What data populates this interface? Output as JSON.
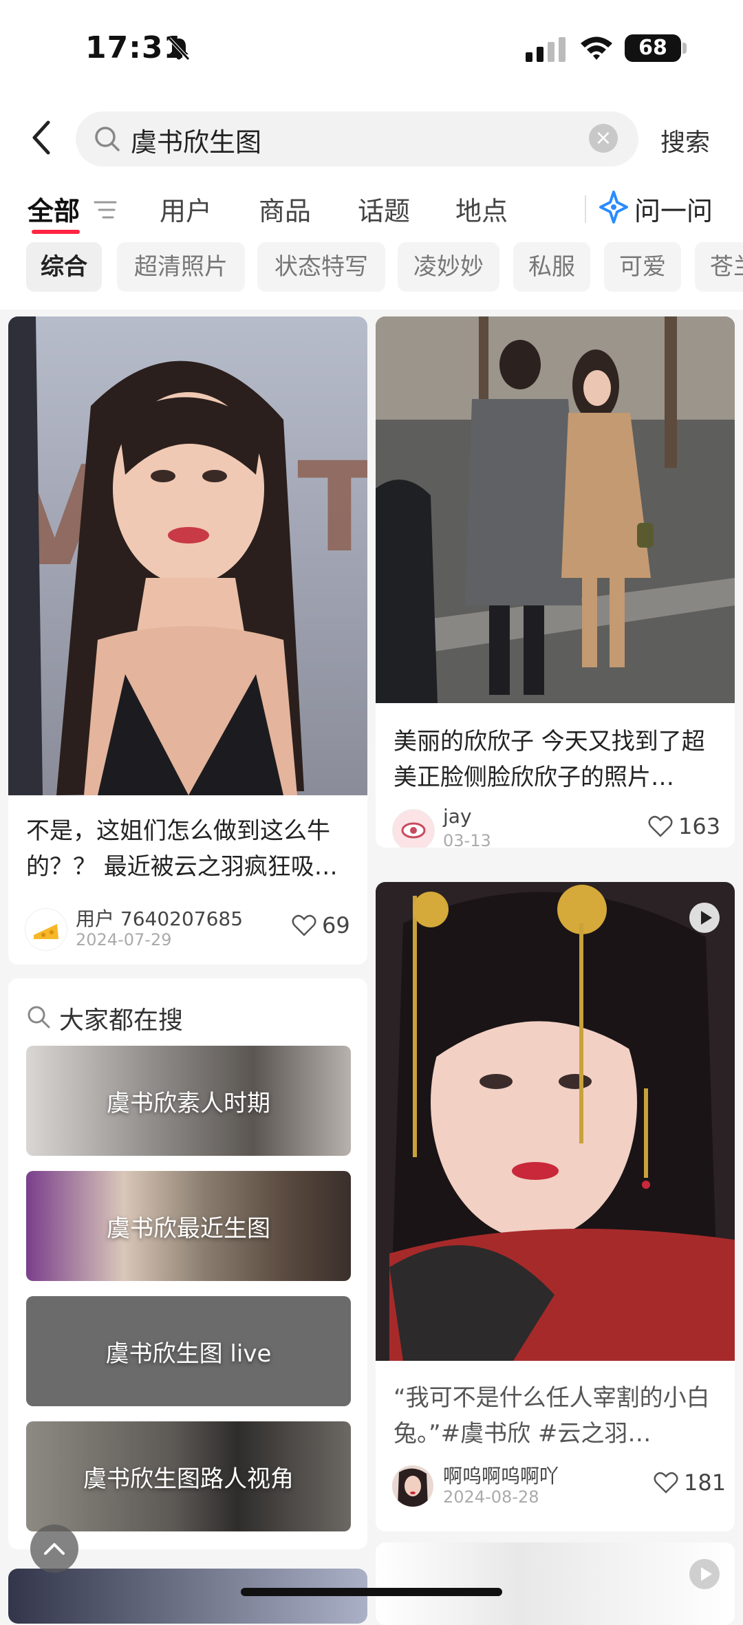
{
  "status": {
    "time": "17:31",
    "battery": "68"
  },
  "search": {
    "query": "虞书欣生图",
    "button": "搜索"
  },
  "tabs": [
    {
      "label": "全部"
    },
    {
      "label": "用户"
    },
    {
      "label": "商品"
    },
    {
      "label": "话题"
    },
    {
      "label": "地点"
    }
  ],
  "ask": {
    "label": "问一问"
  },
  "chips": [
    "综合",
    "超清照片",
    "状态特写",
    "凌妙妙",
    "私服",
    "可爱",
    "苍兰"
  ],
  "cards": {
    "c1": {
      "title": "不是，这姐们怎么做到这么牛的？？ 最近被云之羽疯狂吸…",
      "author": "用户 7640207685",
      "date": "2024-07-29",
      "likes": "69"
    },
    "c2": {
      "title": "美丽的欣欣子 今天又找到了超美正脸侧脸欣欣子的照片…",
      "author": "jay",
      "date": "03-13",
      "likes": "163"
    },
    "c3": {
      "title": "“我可不是什么任人宰割的小白兔。”#虞书欣 #云之羽…",
      "author": "啊呜啊呜啊吖",
      "date": "2024-08-28",
      "likes": "181"
    }
  },
  "hot": {
    "header": "大家都在搜",
    "items": [
      {
        "label": "虞书欣素人时期"
      },
      {
        "label": "虞书欣最近生图"
      },
      {
        "label": "虞书欣生图 live"
      },
      {
        "label": "虞书欣生图路人视角"
      }
    ]
  },
  "colors": {
    "accent": "#ff2442",
    "ask": "#2a8cff"
  }
}
